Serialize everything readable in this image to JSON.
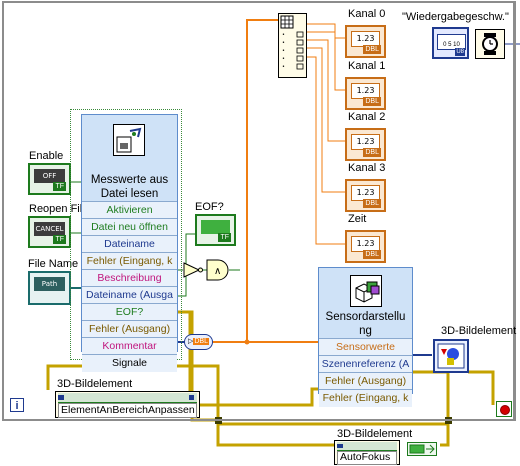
{
  "labels": {
    "enable": "Enable",
    "reopen_file": "Reopen File",
    "file_name": "File Name",
    "eof": "EOF?",
    "kanal0": "Kanal 0",
    "kanal1": "Kanal 1",
    "kanal2": "Kanal 2",
    "kanal3": "Kanal 3",
    "zeit": "Zeit",
    "wiedergabe": "\"Wiedergabegeschw.\"",
    "bild1": "3D-Bildelement",
    "bild2": "3D-Bildelement",
    "bild3": "3D-Bildelement"
  },
  "terminals": {
    "enable_value": "OFF",
    "reopen_value": "CANCEL",
    "path_value": "Path",
    "tf": "TF",
    "dbl": "DBL",
    "dbl_display": "1.23",
    "u8_label": "U8",
    "slider_scale": "0  5  10"
  },
  "messwerte_node": {
    "title": "Messwerte aus Datei lesen",
    "rows": [
      {
        "label": "Aktivieren",
        "color": "#1f7d1f"
      },
      {
        "label": "Datei neu öffnen",
        "color": "#1f7d1f"
      },
      {
        "label": "Dateiname",
        "color": "#1f3a8f"
      },
      {
        "label": "Fehler (Eingang, k",
        "color": "#7a5a00"
      },
      {
        "label": "Beschreibung",
        "color": "#c0157d"
      },
      {
        "label": "Dateiname (Ausga",
        "color": "#1f3a8f"
      },
      {
        "label": "EOF?",
        "color": "#1f7d1f"
      },
      {
        "label": "Fehler (Ausgang)",
        "color": "#7a5a00"
      },
      {
        "label": "Kommentar",
        "color": "#c0157d"
      },
      {
        "label": "Signale",
        "color": "#000000"
      }
    ]
  },
  "sensor_node": {
    "title": "Sensordarstellung",
    "rows": [
      {
        "label": "Sensorwerte",
        "color": "#c76d17"
      },
      {
        "label": "Szenenreferenz (A",
        "color": "#1f3a8f"
      },
      {
        "label": "Fehler (Ausgang)",
        "color": "#7a5a00"
      },
      {
        "label": "Fehler (Eingang, k",
        "color": "#7a5a00"
      }
    ]
  },
  "property_nodes": {
    "element_anpassen": "ElementAnBereichAnpassen",
    "autofokus": "AutoFokus"
  },
  "misc": {
    "info_icon": "i",
    "dyn_conv": "DBL"
  },
  "colors": {
    "bool_wire": "#1d7a1d",
    "path_wire": "#1a6b6b",
    "dbl_wire": "#f07e11",
    "error_wire": "#c4a200",
    "frame": "#8c8c8c"
  }
}
